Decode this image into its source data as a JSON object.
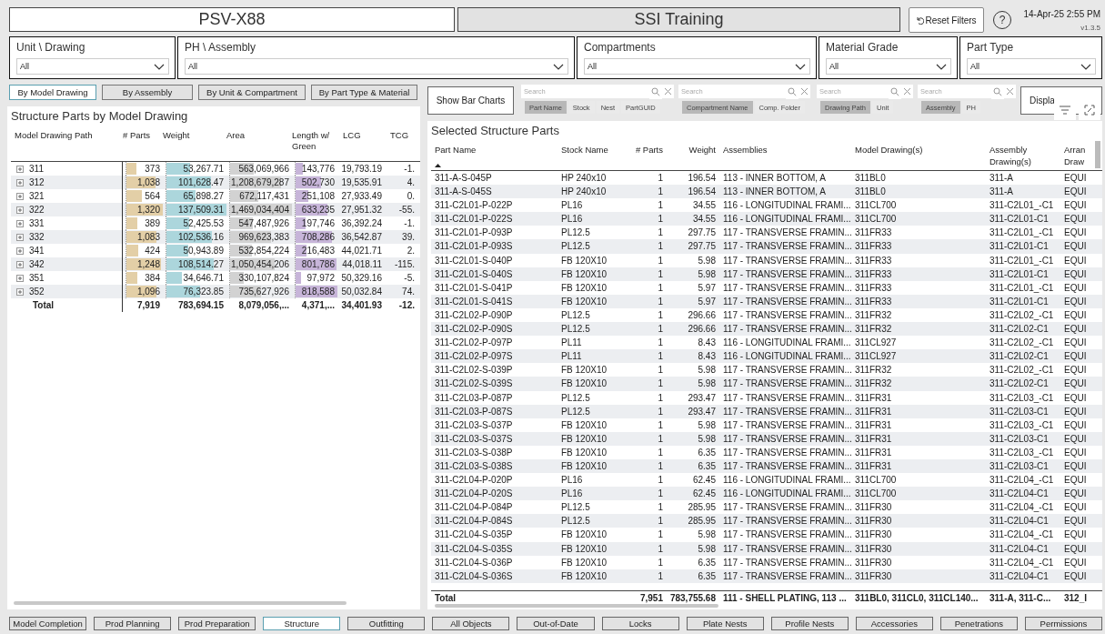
{
  "header": {
    "project": "PSV-X88",
    "environment": "SSI Training",
    "reset_button": "Reset Filters",
    "help_button": "?",
    "datetime": "14-Apr-25 2:55 PM",
    "version": "v1.3.5"
  },
  "filters": [
    {
      "label": "Unit \\ Drawing",
      "value": "All"
    },
    {
      "label": "PH \\ Assembly",
      "value": "All"
    },
    {
      "label": "Compartments",
      "value": "All"
    },
    {
      "label": "Material Grade",
      "value": "All"
    },
    {
      "label": "Part Type",
      "value": "All"
    }
  ],
  "view_buttons": [
    {
      "label": "By Model Drawing",
      "selected": true
    },
    {
      "label": "By Assembly",
      "selected": false
    },
    {
      "label": "By Unit & Compartment",
      "selected": false
    },
    {
      "label": "By Part Type & Material",
      "selected": false
    }
  ],
  "left_table": {
    "title": "Structure Parts by Model Drawing",
    "columns": [
      "Model Drawing Path",
      "# Parts",
      "Weight",
      "Area",
      "Length w/ Green",
      "LCG",
      "TCG"
    ],
    "rows": [
      {
        "expanded": false,
        "cells": [
          {
            "text": "311"
          },
          {
            "text": "373",
            "level": 0.28
          },
          {
            "text": "53,267.71",
            "level": 0.39
          },
          {
            "text": "563,069,966",
            "level": 0.38
          },
          {
            "text": "143,776",
            "level": 0.18
          },
          {
            "text": "19,793.19"
          },
          {
            "text": "-1."
          }
        ]
      },
      {
        "expanded": false,
        "cells": [
          {
            "text": "312"
          },
          {
            "text": "1,038",
            "level": 0.79
          },
          {
            "text": "101,628.47",
            "level": 0.74
          },
          {
            "text": "1,208,679,287",
            "level": 0.82
          },
          {
            "text": "502,730",
            "level": 0.61
          },
          {
            "text": "19,535.91"
          },
          {
            "text": "4."
          }
        ]
      },
      {
        "expanded": false,
        "cells": [
          {
            "text": "321"
          },
          {
            "text": "564",
            "level": 0.43
          },
          {
            "text": "65,898.27",
            "level": 0.48
          },
          {
            "text": "672,117,431",
            "level": 0.46
          },
          {
            "text": "251,108",
            "level": 0.31
          },
          {
            "text": "27,933.49"
          },
          {
            "text": "0."
          }
        ]
      },
      {
        "expanded": false,
        "cells": [
          {
            "text": "322"
          },
          {
            "text": "1,320",
            "level": 1
          },
          {
            "text": "137,509.31",
            "level": 1
          },
          {
            "text": "1,469,034,404",
            "level": 1
          },
          {
            "text": "633,235",
            "level": 0.77
          },
          {
            "text": "27,951.32"
          },
          {
            "text": "-55."
          }
        ]
      },
      {
        "expanded": false,
        "cells": [
          {
            "text": "331"
          },
          {
            "text": "389",
            "level": 0.29
          },
          {
            "text": "52,425.53",
            "level": 0.38
          },
          {
            "text": "547,487,926",
            "level": 0.37
          },
          {
            "text": "197,746",
            "level": 0.24
          },
          {
            "text": "36,392.24"
          },
          {
            "text": "-1."
          }
        ]
      },
      {
        "expanded": false,
        "cells": [
          {
            "text": "332"
          },
          {
            "text": "1,083",
            "level": 0.82
          },
          {
            "text": "102,536.16",
            "level": 0.75
          },
          {
            "text": "969,623,383",
            "level": 0.66
          },
          {
            "text": "708,286",
            "level": 0.87
          },
          {
            "text": "36,542.87"
          },
          {
            "text": "39."
          }
        ]
      },
      {
        "expanded": false,
        "cells": [
          {
            "text": "341"
          },
          {
            "text": "424",
            "level": 0.32
          },
          {
            "text": "50,943.89",
            "level": 0.37
          },
          {
            "text": "532,854,224",
            "level": 0.36
          },
          {
            "text": "216,483",
            "level": 0.26
          },
          {
            "text": "44,021.71"
          },
          {
            "text": "2."
          }
        ]
      },
      {
        "expanded": false,
        "cells": [
          {
            "text": "342"
          },
          {
            "text": "1,248",
            "level": 0.95
          },
          {
            "text": "108,514.27",
            "level": 0.79
          },
          {
            "text": "1,050,454,206",
            "level": 0.72
          },
          {
            "text": "801,786",
            "level": 0.98
          },
          {
            "text": "44,018.11"
          },
          {
            "text": "-115."
          }
        ]
      },
      {
        "expanded": false,
        "cells": [
          {
            "text": "351"
          },
          {
            "text": "384",
            "level": 0.29
          },
          {
            "text": "34,646.71",
            "level": 0.25
          },
          {
            "text": "330,107,824",
            "level": 0.22
          },
          {
            "text": "97,972",
            "level": 0.12
          },
          {
            "text": "50,329.16"
          },
          {
            "text": "-5."
          }
        ]
      },
      {
        "expanded": false,
        "cells": [
          {
            "text": "352"
          },
          {
            "text": "1,096",
            "level": 0.83
          },
          {
            "text": "76,323.85",
            "level": 0.56
          },
          {
            "text": "735,627,926",
            "level": 0.5
          },
          {
            "text": "818,588",
            "level": 1
          },
          {
            "text": "50,032.84"
          },
          {
            "text": "74."
          }
        ]
      }
    ],
    "total": [
      "Total",
      "7,919",
      "783,694.15",
      "8,079,056,...",
      "4,371,...",
      "34,401.93",
      "-12."
    ]
  },
  "toolbar": {
    "bar_charts_button": "Show Bar Charts",
    "slicers": [
      {
        "placeholder": "Search",
        "chips": [
          {
            "label": "Part Name",
            "selected": true
          },
          {
            "label": "Stock",
            "selected": false
          },
          {
            "label": "Nest",
            "selected": false
          },
          {
            "label": "PartGUID",
            "selected": false
          }
        ]
      },
      {
        "placeholder": "Search",
        "chips": [
          {
            "label": "Compartment Name",
            "selected": true
          },
          {
            "label": "Comp. Folder",
            "selected": false
          }
        ]
      },
      {
        "placeholder": "Search",
        "chips": [
          {
            "label": "Drawing Path",
            "selected": true
          },
          {
            "label": "Unit",
            "selected": false
          }
        ]
      },
      {
        "placeholder": "Search",
        "chips": [
          {
            "label": "Assembly",
            "selected": true
          },
          {
            "label": "PH",
            "selected": false
          }
        ]
      }
    ],
    "display_button": "Displa"
  },
  "right_table": {
    "title": "Selected Structure Parts",
    "columns": [
      {
        "label": "Part Name",
        "sorted_ascending": true
      },
      {
        "label": "Stock Name",
        "sorted_ascending": false
      },
      {
        "label": "# Parts",
        "sorted_ascending": false
      },
      {
        "label": "Weight",
        "sorted_ascending": false
      },
      {
        "label": "Assemblies",
        "sorted_ascending": false
      },
      {
        "label": "Model Drawing(s)",
        "sorted_ascending": false
      },
      {
        "label": "Assembly Drawing(s)",
        "sorted_ascending": false
      },
      {
        "label": "Arran Draw",
        "sorted_ascending": false
      }
    ],
    "rows": [
      [
        "311-A-S-045P",
        "HP 240x10",
        "1",
        "196.54",
        "113 - INNER BOTTOM, A",
        "311BL0",
        "311-A",
        "EQUI"
      ],
      [
        "311-A-S-045S",
        "HP 240x10",
        "1",
        "196.54",
        "113 - INNER BOTTOM, A",
        "311BL0",
        "311-A",
        "EQUI"
      ],
      [
        "311-C2L01-P-022P",
        "PL16",
        "1",
        "34.55",
        "116 - LONGITUDINAL FRAMI...",
        "311CL700",
        "311-C2L01_-C1",
        "EQUI"
      ],
      [
        "311-C2L01-P-022S",
        "PL16",
        "1",
        "34.55",
        "116 - LONGITUDINAL FRAMI...",
        "311CL700",
        "311-C2L01-C1",
        "EQUI"
      ],
      [
        "311-C2L01-P-093P",
        "PL12.5",
        "1",
        "297.75",
        "117 - TRANSVERSE FRAMIN...",
        "311FR33",
        "311-C2L01_-C1",
        "EQUI"
      ],
      [
        "311-C2L01-P-093S",
        "PL12.5",
        "1",
        "297.75",
        "117 - TRANSVERSE FRAMIN...",
        "311FR33",
        "311-C2L01-C1",
        "EQUI"
      ],
      [
        "311-C2L01-S-040P",
        "FB 120X10",
        "1",
        "5.98",
        "117 - TRANSVERSE FRAMIN...",
        "311FR33",
        "311-C2L01_-C1",
        "EQUI"
      ],
      [
        "311-C2L01-S-040S",
        "FB 120X10",
        "1",
        "5.98",
        "117 - TRANSVERSE FRAMIN...",
        "311FR33",
        "311-C2L01-C1",
        "EQUI"
      ],
      [
        "311-C2L01-S-041P",
        "FB 120X10",
        "1",
        "5.97",
        "117 - TRANSVERSE FRAMIN...",
        "311FR33",
        "311-C2L01_-C1",
        "EQUI"
      ],
      [
        "311-C2L01-S-041S",
        "FB 120X10",
        "1",
        "5.97",
        "117 - TRANSVERSE FRAMIN...",
        "311FR33",
        "311-C2L01-C1",
        "EQUI"
      ],
      [
        "311-C2L02-P-090P",
        "PL12.5",
        "1",
        "296.66",
        "117 - TRANSVERSE FRAMIN...",
        "311FR32",
        "311-C2L02_-C1",
        "EQUI"
      ],
      [
        "311-C2L02-P-090S",
        "PL12.5",
        "1",
        "296.66",
        "117 - TRANSVERSE FRAMIN...",
        "311FR32",
        "311-C2L02-C1",
        "EQUI"
      ],
      [
        "311-C2L02-P-097P",
        "PL11",
        "1",
        "8.43",
        "116 - LONGITUDINAL FRAMI...",
        "311CL927",
        "311-C2L02_-C1",
        "EQUI"
      ],
      [
        "311-C2L02-P-097S",
        "PL11",
        "1",
        "8.43",
        "116 - LONGITUDINAL FRAMI...",
        "311CL927",
        "311-C2L02-C1",
        "EQUI"
      ],
      [
        "311-C2L02-S-039P",
        "FB 120X10",
        "1",
        "5.98",
        "117 - TRANSVERSE FRAMIN...",
        "311FR32",
        "311-C2L02_-C1",
        "EQUI"
      ],
      [
        "311-C2L02-S-039S",
        "FB 120X10",
        "1",
        "5.98",
        "117 - TRANSVERSE FRAMIN...",
        "311FR32",
        "311-C2L02-C1",
        "EQUI"
      ],
      [
        "311-C2L03-P-087P",
        "PL12.5",
        "1",
        "293.47",
        "117 - TRANSVERSE FRAMIN...",
        "311FR31",
        "311-C2L03_-C1",
        "EQUI"
      ],
      [
        "311-C2L03-P-087S",
        "PL12.5",
        "1",
        "293.47",
        "117 - TRANSVERSE FRAMIN...",
        "311FR31",
        "311-C2L03-C1",
        "EQUI"
      ],
      [
        "311-C2L03-S-037P",
        "FB 120X10",
        "1",
        "5.98",
        "117 - TRANSVERSE FRAMIN...",
        "311FR31",
        "311-C2L03_-C1",
        "EQUI"
      ],
      [
        "311-C2L03-S-037S",
        "FB 120X10",
        "1",
        "5.98",
        "117 - TRANSVERSE FRAMIN...",
        "311FR31",
        "311-C2L03-C1",
        "EQUI"
      ],
      [
        "311-C2L03-S-038P",
        "FB 120X10",
        "1",
        "6.35",
        "117 - TRANSVERSE FRAMIN...",
        "311FR31",
        "311-C2L03_-C1",
        "EQUI"
      ],
      [
        "311-C2L03-S-038S",
        "FB 120X10",
        "1",
        "6.35",
        "117 - TRANSVERSE FRAMIN...",
        "311FR31",
        "311-C2L03-C1",
        "EQUI"
      ],
      [
        "311-C2L04-P-020P",
        "PL16",
        "1",
        "62.45",
        "116 - LONGITUDINAL FRAMI...",
        "311CL700",
        "311-C2L04_-C1",
        "EQUI"
      ],
      [
        "311-C2L04-P-020S",
        "PL16",
        "1",
        "62.45",
        "116 - LONGITUDINAL FRAMI...",
        "311CL700",
        "311-C2L04-C1",
        "EQUI"
      ],
      [
        "311-C2L04-P-084P",
        "PL12.5",
        "1",
        "285.95",
        "117 - TRANSVERSE FRAMIN...",
        "311FR30",
        "311-C2L04_-C1",
        "EQUI"
      ],
      [
        "311-C2L04-P-084S",
        "PL12.5",
        "1",
        "285.95",
        "117 - TRANSVERSE FRAMIN...",
        "311FR30",
        "311-C2L04-C1",
        "EQUI"
      ],
      [
        "311-C2L04-S-035P",
        "FB 120X10",
        "1",
        "5.98",
        "117 - TRANSVERSE FRAMIN...",
        "311FR30",
        "311-C2L04_-C1",
        "EQUI"
      ],
      [
        "311-C2L04-S-035S",
        "FB 120X10",
        "1",
        "5.98",
        "117 - TRANSVERSE FRAMIN...",
        "311FR30",
        "311-C2L04-C1",
        "EQUI"
      ],
      [
        "311-C2L04-S-036P",
        "FB 120X10",
        "1",
        "6.35",
        "117 - TRANSVERSE FRAMIN...",
        "311FR30",
        "311-C2L04_-C1",
        "EQUI"
      ],
      [
        "311-C2L04-S-036S",
        "FB 120X10",
        "1",
        "6.35",
        "117 - TRANSVERSE FRAMIN...",
        "311FR30",
        "311-C2L04-C1",
        "EQUI"
      ]
    ],
    "total": {
      "label": "Total",
      "values": [
        "7,951",
        "783,755.68",
        "111 - SHELL PLATING, 113 ...",
        "311BL0, 311CL0, 311CL140...",
        "311-A, 311-C...",
        "312_I"
      ]
    }
  },
  "page_tabs": [
    {
      "label": "Model Completion",
      "selected": false
    },
    {
      "label": "Prod Planning",
      "selected": false
    },
    {
      "label": "Prod Preparation",
      "selected": false
    },
    {
      "label": "Structure",
      "selected": true
    },
    {
      "label": "Outfitting",
      "selected": false
    },
    {
      "label": "All Objects",
      "selected": false
    },
    {
      "label": "Out-of-Date",
      "selected": false
    },
    {
      "label": "Locks",
      "selected": false
    },
    {
      "label": "Plate Nests",
      "selected": false
    },
    {
      "label": "Profile Nests",
      "selected": false
    },
    {
      "label": "Accessories",
      "selected": false
    },
    {
      "label": "Penetrations",
      "selected": false
    },
    {
      "label": "Permissions",
      "selected": false
    }
  ]
}
